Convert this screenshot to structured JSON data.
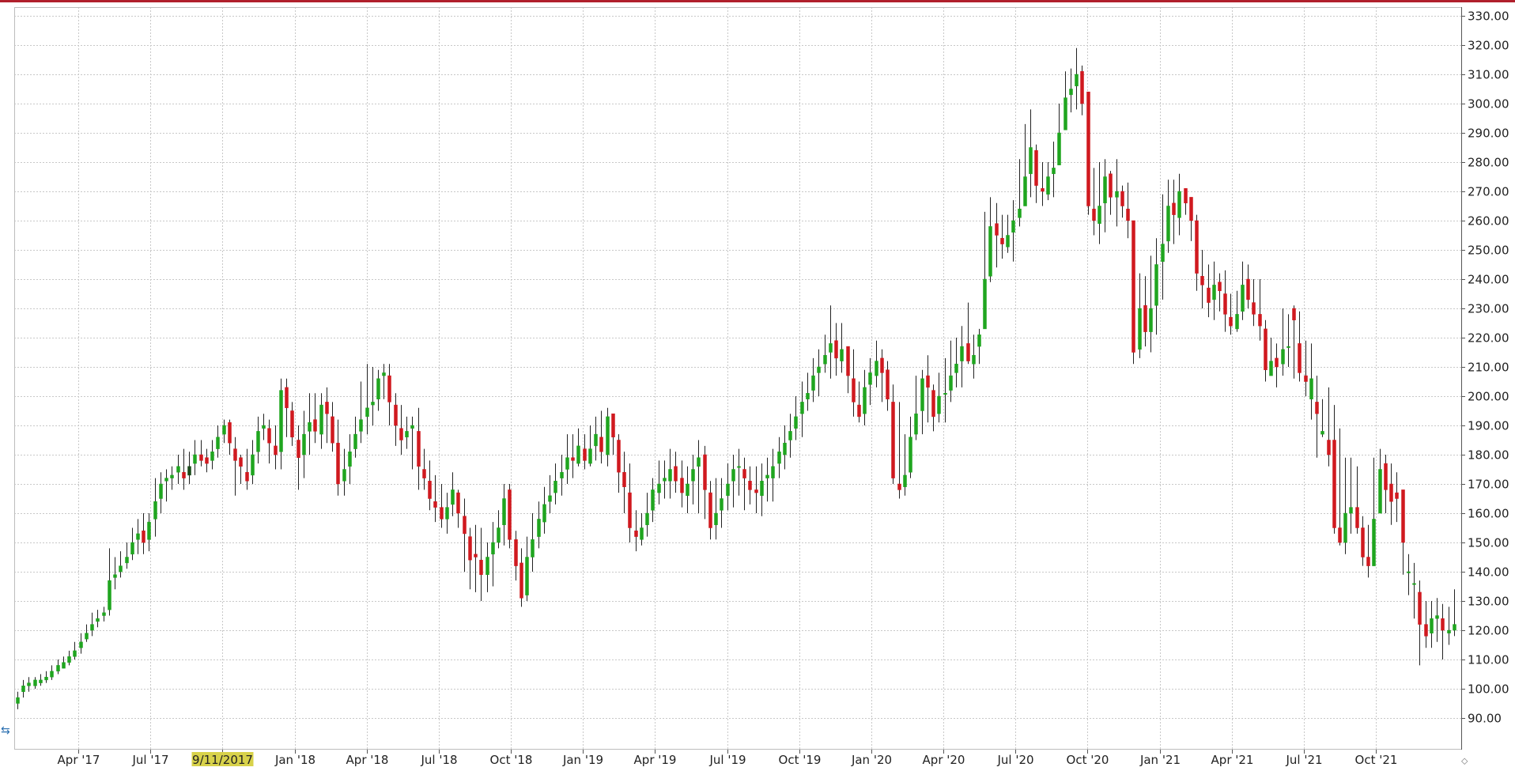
{
  "chart_data": {
    "type": "candlestick",
    "title": "",
    "xlabel": "",
    "ylabel": "",
    "ylim": [
      82,
      333
    ],
    "y_ticks": [
      "330.00",
      "320.00",
      "310.00",
      "300.00",
      "290.00",
      "280.00",
      "270.00",
      "260.00",
      "250.00",
      "240.00",
      "230.00",
      "220.00",
      "210.00",
      "200.00",
      "190.00",
      "180.00",
      "170.00",
      "160.00",
      "150.00",
      "140.00",
      "130.00",
      "120.00",
      "110.00",
      "100.00",
      "90.00"
    ],
    "x_ticks": [
      "Apr '17",
      "Jul '17",
      "Sep '17",
      "Jan '18",
      "Apr '18",
      "Jul '18",
      "Oct '18",
      "Jan '19",
      "Apr '19",
      "Jul '19",
      "Oct '19",
      "Jan '20",
      "Apr '20",
      "Jul '20",
      "Oct '20",
      "Jan '21",
      "Apr '21",
      "Jul '21",
      "Oct '21"
    ],
    "highlight_label": "9/11/2017",
    "grid": true,
    "colors": {
      "up": "#1fa51f",
      "down": "#d0191f",
      "grid": "#c8c8c8",
      "axis": "#555555",
      "highlight": "#d8d24a",
      "selected": "#1a4a1a"
    },
    "close": [
      97,
      101,
      102,
      103,
      103,
      104,
      106,
      108,
      109,
      111,
      113,
      116,
      119,
      122,
      124,
      126,
      137,
      139,
      142,
      145,
      150,
      153,
      150,
      157,
      164,
      170,
      172,
      173,
      176,
      172,
      176,
      180,
      178,
      177,
      181,
      186,
      190,
      184,
      178,
      176,
      171,
      180,
      188,
      190,
      184,
      180,
      202,
      196,
      186,
      179,
      187,
      191,
      188,
      197,
      194,
      184,
      170,
      175,
      181,
      187,
      192,
      196,
      198,
      206,
      208,
      198,
      190,
      185,
      188,
      190,
      176,
      172,
      165,
      162,
      158,
      162,
      168,
      160,
      153,
      144,
      145,
      139,
      145,
      150,
      155,
      165,
      151,
      142,
      131,
      145,
      151,
      158,
      163,
      166,
      171,
      174,
      179,
      178,
      183,
      178,
      182,
      187,
      181,
      193,
      186,
      174,
      169,
      155,
      152,
      155,
      160,
      168,
      170,
      172,
      175,
      171,
      167,
      170,
      175,
      179,
      168,
      155,
      160,
      165,
      170,
      175,
      176,
      172,
      168,
      167,
      171,
      173,
      176,
      181,
      184,
      188,
      193,
      198,
      201,
      207,
      210,
      214,
      218,
      213,
      216,
      207,
      198,
      193,
      203,
      208,
      212,
      208,
      199,
      172,
      168,
      173,
      186,
      194,
      206,
      203,
      193,
      200,
      201,
      207,
      211,
      217,
      212,
      214,
      221,
      240,
      258,
      255,
      252,
      255,
      260,
      264,
      275,
      285,
      272,
      270,
      275,
      278,
      290,
      302,
      305,
      310,
      300,
      265,
      260,
      265,
      275,
      268,
      270,
      265,
      260,
      215,
      230,
      222,
      230,
      245,
      252,
      265,
      262,
      270,
      266,
      260,
      242,
      238,
      232,
      238,
      236,
      228,
      224,
      228,
      238,
      233,
      228,
      224,
      209,
      212,
      210,
      216,
      217,
      226,
      208,
      205,
      206,
      194,
      188,
      180,
      155,
      150,
      160,
      162,
      155,
      145,
      142,
      158,
      175,
      168,
      164,
      165,
      150,
      140,
      136,
      122,
      118,
      124,
      125,
      120,
      120,
      122,
      130
    ],
    "open": [
      95,
      99,
      101,
      101,
      102,
      103,
      104,
      106,
      107,
      109,
      111,
      114,
      117,
      120,
      123,
      125,
      127,
      138,
      140,
      143,
      146,
      151,
      154,
      151,
      158,
      165,
      171,
      172,
      174,
      174,
      173,
      177,
      180,
      179,
      178,
      182,
      187,
      191,
      182,
      179,
      174,
      173,
      181,
      189,
      189,
      183,
      181,
      203,
      195,
      185,
      180,
      188,
      192,
      187,
      198,
      193,
      184,
      171,
      176,
      182,
      188,
      193,
      197,
      199,
      207,
      207,
      197,
      189,
      186,
      189,
      188,
      175,
      171,
      164,
      162,
      158,
      163,
      167,
      159,
      152,
      146,
      144,
      139,
      146,
      150,
      156,
      168,
      151,
      143,
      132,
      145,
      152,
      157,
      164,
      167,
      172,
      175,
      179,
      177,
      182,
      177,
      183,
      186,
      180,
      194,
      185,
      174,
      167,
      154,
      151,
      156,
      161,
      167,
      171,
      171,
      176,
      172,
      166,
      171,
      176,
      180,
      167,
      156,
      161,
      166,
      171,
      176,
      175,
      171,
      168,
      166,
      172,
      172,
      177,
      180,
      185,
      189,
      194,
      199,
      202,
      208,
      211,
      215,
      219,
      212,
      217,
      206,
      197,
      194,
      204,
      207,
      213,
      209,
      198,
      170,
      169,
      174,
      187,
      195,
      207,
      202,
      194,
      201,
      202,
      208,
      212,
      218,
      211,
      217,
      223,
      241,
      259,
      254,
      251,
      256,
      261,
      265,
      276,
      284,
      271,
      269,
      276,
      279,
      291,
      303,
      306,
      311,
      304,
      264,
      259,
      266,
      276,
      268,
      270,
      264,
      260,
      216,
      231,
      222,
      231,
      246,
      253,
      266,
      261,
      271,
      268,
      260,
      241,
      237,
      233,
      239,
      235,
      227,
      223,
      229,
      240,
      232,
      228,
      223,
      207,
      213,
      211,
      217,
      230,
      218,
      207,
      199,
      198,
      187,
      185,
      185,
      155,
      150,
      160,
      162,
      155,
      145,
      142,
      160,
      177,
      170,
      167,
      168,
      140,
      136,
      133,
      122,
      119,
      124,
      124,
      119,
      120
    ],
    "high": [
      99,
      103,
      104,
      104,
      105,
      106,
      108,
      110,
      111,
      113,
      116,
      119,
      122,
      126,
      127,
      128,
      148,
      145,
      147,
      150,
      155,
      158,
      160,
      160,
      172,
      174,
      175,
      176,
      180,
      182,
      181,
      185,
      185,
      182,
      185,
      190,
      192,
      192,
      186,
      180,
      182,
      185,
      193,
      194,
      192,
      190,
      206,
      206,
      198,
      190,
      195,
      201,
      201,
      201,
      203,
      198,
      192,
      182,
      187,
      193,
      205,
      211,
      210,
      209,
      211,
      211,
      201,
      197,
      193,
      193,
      196,
      182,
      178,
      173,
      170,
      167,
      174,
      168,
      165,
      155,
      156,
      155,
      150,
      157,
      161,
      170,
      170,
      154,
      148,
      152,
      160,
      164,
      169,
      173,
      177,
      180,
      187,
      187,
      189,
      187,
      190,
      193,
      195,
      196,
      193,
      187,
      181,
      177,
      161,
      160,
      167,
      172,
      178,
      178,
      182,
      181,
      178,
      176,
      180,
      185,
      183,
      171,
      172,
      172,
      177,
      180,
      182,
      179,
      176,
      176,
      177,
      179,
      182,
      186,
      190,
      194,
      200,
      205,
      208,
      213,
      216,
      221,
      231,
      225,
      225,
      217,
      216,
      205,
      209,
      213,
      219,
      216,
      212,
      204,
      198,
      187,
      193,
      207,
      209,
      214,
      204,
      208,
      213,
      219,
      220,
      224,
      232,
      221,
      223,
      263,
      268,
      266,
      262,
      262,
      267,
      281,
      293,
      298,
      286,
      280,
      280,
      287,
      300,
      311,
      312,
      319,
      313,
      304,
      278,
      280,
      281,
      277,
      281,
      272,
      273,
      241,
      242,
      241,
      248,
      254,
      269,
      274,
      274,
      276,
      271,
      263,
      262,
      250,
      245,
      246,
      242,
      243,
      235,
      236,
      246,
      245,
      240,
      240,
      226,
      220,
      218,
      230,
      228,
      231,
      229,
      219,
      218,
      207,
      199,
      203,
      197,
      189,
      179,
      179,
      176,
      159,
      156,
      179,
      182,
      180,
      177,
      174,
      167,
      146,
      143,
      137,
      130,
      130,
      131,
      129,
      128,
      134
    ],
    "low": [
      93,
      97,
      99,
      100,
      101,
      102,
      103,
      105,
      107,
      108,
      110,
      112,
      116,
      118,
      121,
      123,
      125,
      134,
      138,
      141,
      144,
      146,
      146,
      147,
      152,
      160,
      164,
      168,
      170,
      168,
      170,
      173,
      176,
      174,
      175,
      179,
      184,
      180,
      166,
      170,
      168,
      170,
      177,
      185,
      177,
      175,
      175,
      186,
      183,
      168,
      172,
      180,
      184,
      182,
      184,
      181,
      166,
      166,
      170,
      179,
      184,
      187,
      190,
      195,
      199,
      190,
      183,
      180,
      182,
      175,
      168,
      168,
      161,
      157,
      155,
      153,
      159,
      155,
      140,
      134,
      133,
      130,
      133,
      135,
      148,
      149,
      148,
      137,
      128,
      130,
      140,
      148,
      153,
      160,
      163,
      166,
      170,
      172,
      176,
      175,
      176,
      178,
      177,
      176,
      180,
      167,
      160,
      150,
      147,
      149,
      152,
      157,
      163,
      165,
      165,
      167,
      162,
      160,
      163,
      160,
      158,
      151,
      151,
      155,
      161,
      162,
      166,
      161,
      163,
      160,
      159,
      164,
      164,
      172,
      175,
      179,
      185,
      186,
      195,
      198,
      200,
      208,
      206,
      207,
      208,
      201,
      193,
      191,
      190,
      197,
      203,
      198,
      195,
      170,
      165,
      166,
      172,
      185,
      187,
      191,
      188,
      191,
      191,
      198,
      203,
      203,
      211,
      206,
      211,
      231,
      239,
      244,
      247,
      249,
      246,
      258,
      266,
      268,
      266,
      265,
      267,
      268,
      280,
      291,
      297,
      298,
      296,
      262,
      255,
      252,
      256,
      262,
      258,
      261,
      254,
      211,
      213,
      217,
      215,
      221,
      233,
      249,
      252,
      255,
      262,
      253,
      236,
      230,
      227,
      226,
      229,
      222,
      221,
      222,
      226,
      230,
      224,
      219,
      205,
      208,
      203,
      207,
      210,
      206,
      205,
      200,
      192,
      179,
      186,
      176,
      153,
      149,
      146,
      153,
      153,
      142,
      138,
      142,
      165,
      160,
      156,
      157,
      139,
      132,
      124,
      108,
      114,
      114,
      116,
      110,
      115,
      118
    ]
  }
}
